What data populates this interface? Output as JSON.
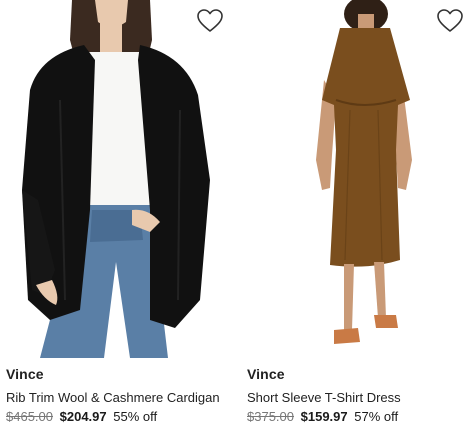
{
  "products": [
    {
      "brand": "Vince",
      "title": "Rib Trim Wool & Cashmere Cardigan",
      "original_price": "$465.00",
      "sale_price": "$204.97",
      "discount": "55% off",
      "favorite_icon": "heart-outline-icon"
    },
    {
      "brand": "Vince",
      "title": "Short Sleeve T-Shirt Dress",
      "original_price": "$375.00",
      "sale_price": "$159.97",
      "discount": "57% off",
      "favorite_icon": "heart-outline-icon"
    }
  ],
  "colors": {
    "cardigan": "#111111",
    "tee": "#f7f7f5",
    "jeans": "#5a7fa6",
    "skin": "#e8c9ae",
    "dress": "#7a4e1e",
    "sandal": "#c97a45",
    "sale_text": "#1a1a1a",
    "strike_text": "#777777"
  }
}
